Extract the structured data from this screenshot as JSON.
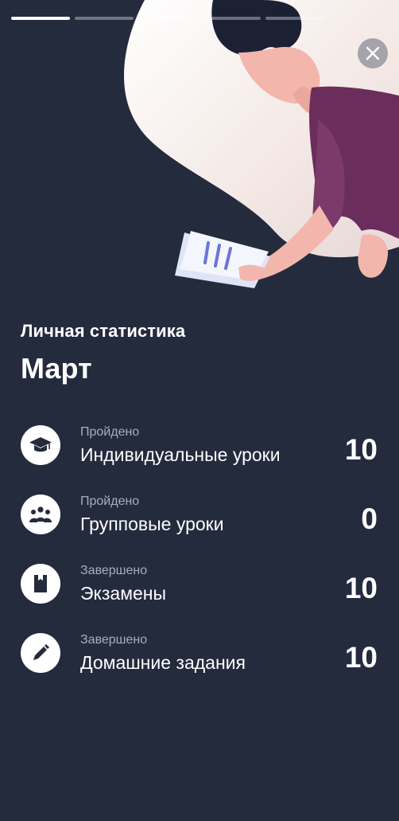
{
  "story": {
    "progress": {
      "segments": 5,
      "active_index": 0
    },
    "subtitle": "Личная статистика",
    "title": "Март"
  },
  "close_icon": "close-icon",
  "stats": [
    {
      "caption": "Пройдено",
      "label": "Индивидуальные уроки",
      "value": "10",
      "icon": "graduation-cap-icon"
    },
    {
      "caption": "Пройдено",
      "label": "Групповые уроки",
      "value": "0",
      "icon": "group-icon"
    },
    {
      "caption": "Завершено",
      "label": "Экзамены",
      "value": "10",
      "icon": "document-icon"
    },
    {
      "caption": "Завершено",
      "label": "Домашние задания",
      "value": "10",
      "icon": "pen-icon"
    }
  ],
  "colors": {
    "background": "#242b3d",
    "icon_background": "#ffffff",
    "icon_glyph": "#242b3d",
    "caption": "#a9aebb",
    "accent_shirt": "#6b2d5c",
    "blob": "#f2e6e2"
  }
}
